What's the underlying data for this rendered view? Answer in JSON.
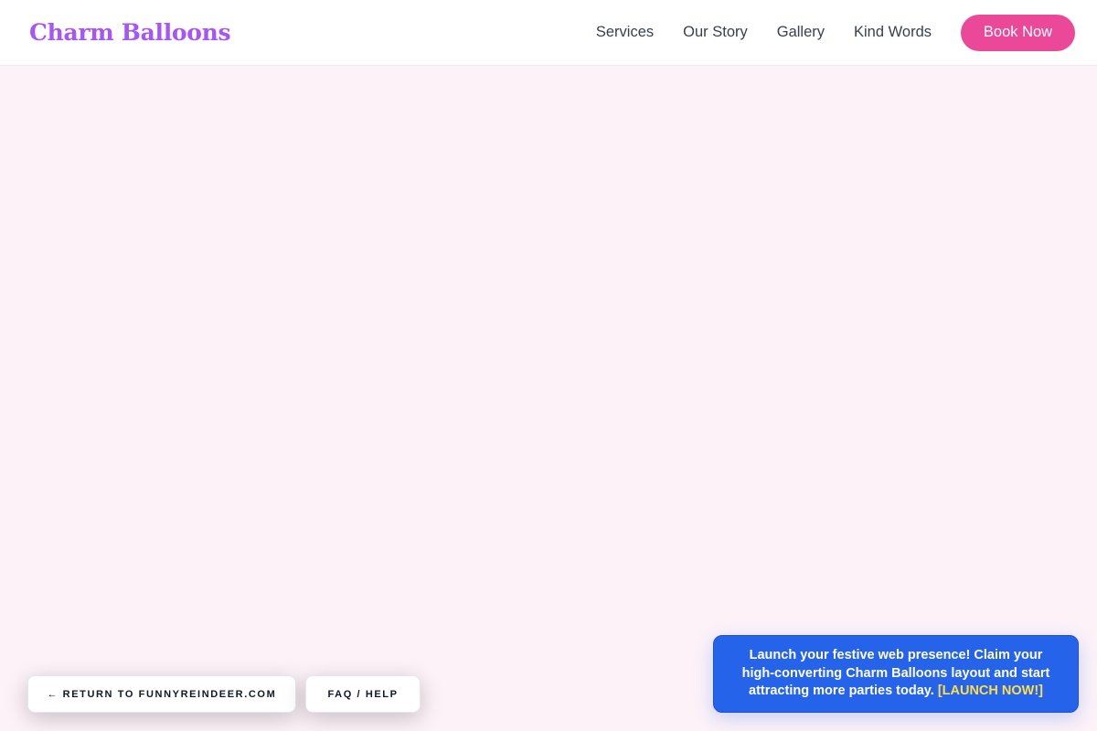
{
  "brand": {
    "name": "Charm Balloons",
    "color": "#a855f7"
  },
  "nav": {
    "items": [
      {
        "label": "Services"
      },
      {
        "label": "Our Story"
      },
      {
        "label": "Gallery"
      },
      {
        "label": "Kind Words"
      }
    ],
    "cta_label": "Book Now",
    "cta_color": "#ec4899"
  },
  "footer_pills": {
    "return_arrow": "←",
    "return_label": "RETURN TO FUNNYREINDEER.COM",
    "faq_label": "FAQ / HELP"
  },
  "promo": {
    "message": "Launch your festive web presence! Claim your high-converting Charm Balloons layout and start attracting more parties today.",
    "cta": "[LAUNCH NOW!]",
    "background": "#2563eb",
    "cta_color": "#fde047"
  },
  "page_background": "#fdf2f8"
}
